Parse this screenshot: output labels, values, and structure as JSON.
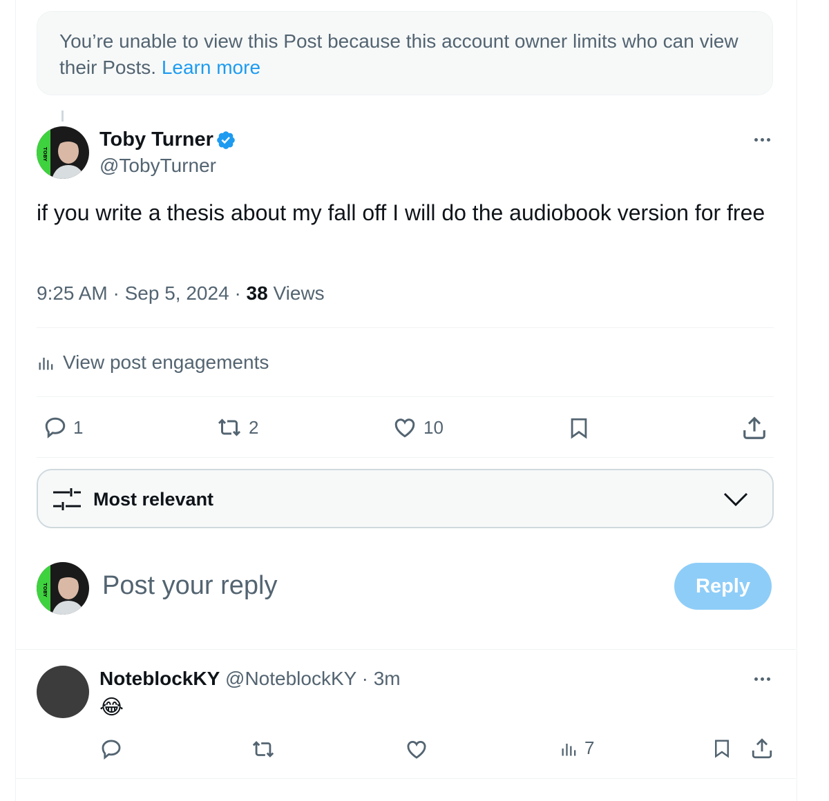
{
  "notice": {
    "text": "You’re unable to view this Post because this account owner limits who can view their Posts.",
    "link": "Learn more"
  },
  "post": {
    "author_name": "Toby Turner",
    "author_handle": "@TobyTurner",
    "avatar_label": "TOBY",
    "verified": true,
    "text": "if you write a thesis about my fall off I will do the audiobook version for free",
    "time": "9:25 AM",
    "date": "Sep 5, 2024",
    "views_count": "38",
    "views_label": "Views",
    "engagements_label": "View post engagements",
    "actions": {
      "replies": "1",
      "reposts": "2",
      "likes": "10"
    }
  },
  "sort": {
    "label": "Most relevant"
  },
  "composer": {
    "placeholder": "Post your reply",
    "button": "Reply"
  },
  "reply": {
    "author_name": "NoteblockKY",
    "author_handle": "@NoteblockKY",
    "time": "3m",
    "text": "😂",
    "views": "7"
  },
  "colors": {
    "accent": "#1d9bf0",
    "muted": "#536471",
    "reply_button_disabled": "#8ecdf8",
    "notice_bg": "#f7f9f9"
  },
  "icons": [
    "verified-badge-icon",
    "more-icon",
    "analytics-icon",
    "reply-icon",
    "repost-icon",
    "like-icon",
    "bookmark-icon",
    "share-icon",
    "filter-icon",
    "chevron-down-icon"
  ]
}
